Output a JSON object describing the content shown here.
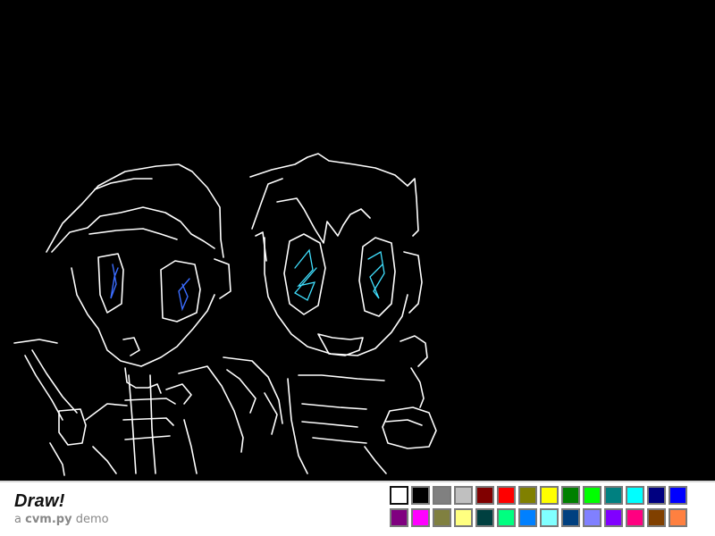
{
  "app": {
    "title": "Draw!",
    "subtitle_prefix": "a",
    "subtitle_brand": "cvm.py",
    "subtitle_suffix": "demo"
  },
  "canvas": {
    "background": "#000000"
  },
  "palette": {
    "selected": "#ffffff",
    "colors": [
      "#ffffff",
      "#000000",
      "#808080",
      "#c0c0c0",
      "#800000",
      "#ff0000",
      "#808000",
      "#ffff00",
      "#008000",
      "#00ff00",
      "#008080",
      "#00ffff",
      "#000080",
      "#0000ff",
      "#800080",
      "#ff00ff",
      "#808040",
      "#ffff80",
      "#004040",
      "#00ff80",
      "#0080ff",
      "#80ffff",
      "#004080",
      "#8080ff",
      "#8000ff",
      "#ff0080",
      "#804000",
      "#ff8040"
    ]
  }
}
